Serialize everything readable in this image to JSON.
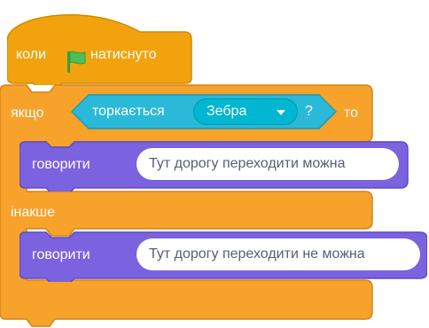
{
  "colors": {
    "events": "#ffbf00",
    "control": "#ffab19",
    "control_dark": "#cf8b17",
    "sensing": "#5cb1d6",
    "touching": "#4cbfe6",
    "looks": "#9966ff",
    "looks_dark": "#5c5cc9",
    "flag": "#4cbf56"
  },
  "hat_block": {
    "prefix": "коли",
    "icon": "green-flag-icon",
    "suffix": "натиснуто"
  },
  "if_block": {
    "if_label": "якщо",
    "then_label": "то",
    "else_label": "інакше",
    "condition": {
      "label": "торкається",
      "dropdown_value": "Зебра",
      "question": "?"
    }
  },
  "say_blocks": [
    {
      "label": "говорити",
      "message": "Тут дорогу переходити можна"
    },
    {
      "label": "говорити",
      "message": "Тут дорогу переходити не можна"
    }
  ]
}
